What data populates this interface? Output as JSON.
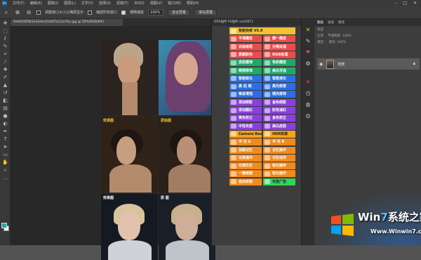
{
  "menubar": {
    "items": [
      "文件(F)",
      "编辑(E)",
      "图像(I)",
      "图层(L)",
      "文字(Y)",
      "选择(S)",
      "滤镜(T)",
      "3D(D)",
      "视图(V)",
      "窗口(W)",
      "帮助(H)"
    ],
    "app_logo": "Ps"
  },
  "options": {
    "resize_windows_label": "调整窗口大小以满屏显示",
    "zoom_all_label": "缩放所有窗口",
    "scrubby_zoom_label": "细微缩放",
    "zoom_value": "100%",
    "fit_screen_label": "适合屏幕",
    "fill_screen_label": "填充屏幕"
  },
  "document": {
    "tab_label": "6de62060b1e43dec41dd15a11e7ba.jpg @ 50%(RGB/8#)"
  },
  "photos": {
    "label_after_1": "效果图",
    "label_before_1": "原始图",
    "label_after_2": "效果图",
    "label_before_2": "原 图"
  },
  "plugin_panel": {
    "title": "DR5插件 PS插件 sw59KT1",
    "buttons": [
      {
        "label": "智能快修 V5.0",
        "color": "#f2c232"
      },
      {
        "label": "平滑磨皮",
        "color": "#e84c4c"
      },
      {
        "label": "磨一磨皮",
        "color": "#e84c4c"
      },
      {
        "label": "去除痘斑",
        "color": "#e84c4c"
      },
      {
        "label": "分频处理",
        "color": "#e84c4c"
      },
      {
        "label": "素颜肤色",
        "color": "#e84c4c"
      },
      {
        "label": "D&B处理",
        "color": "#e84c4c"
      },
      {
        "label": "皮肤磨滑",
        "color": "#1ea96a"
      },
      {
        "label": "色彩磨皮",
        "color": "#1ea96a"
      },
      {
        "label": "眼部修饰",
        "color": "#1ea96a"
      },
      {
        "label": "美白牙齿",
        "color": "#1ea96a"
      },
      {
        "label": "智能锐化",
        "color": "#2b6fe8"
      },
      {
        "label": "智能液化",
        "color": "#2b6fe8"
      },
      {
        "label": "高 低 频",
        "color": "#2b6fe8"
      },
      {
        "label": "高光修复",
        "color": "#2b6fe8"
      },
      {
        "label": "噪音增强",
        "color": "#2b6fe8"
      },
      {
        "label": "镜光修饰",
        "color": "#2b6fe8"
      },
      {
        "label": "添加眼影",
        "color": "#8a3fe0"
      },
      {
        "label": "金色眼影",
        "color": "#8a3fe0"
      },
      {
        "label": "添加腮红",
        "color": "#8a3fe0"
      },
      {
        "label": "肤色减红",
        "color": "#8a3fe0"
      },
      {
        "label": "黄色校正",
        "color": "#8a3fe0"
      },
      {
        "label": "金色校正",
        "color": "#8a3fe0"
      },
      {
        "label": "中性灰度",
        "color": "#8a3fe0"
      },
      {
        "label": "美白皮肤",
        "color": "#8a3fe0"
      },
      {
        "label": "Camera Raw",
        "color": "#f2a51c"
      },
      {
        "label": "HDR效果",
        "color": "#f2a51c"
      },
      {
        "label": "冲 光 A",
        "color": "#f28a1c"
      },
      {
        "label": "冲 光 B",
        "color": "#f28a1c"
      },
      {
        "label": "加载记忆",
        "color": "#f28a1c"
      },
      {
        "label": "记忆操作",
        "color": "#f28a1c"
      },
      {
        "label": "记录操作",
        "color": "#f28a1c"
      },
      {
        "label": "记忆动作",
        "color": "#f28a1c"
      },
      {
        "label": "记录历史",
        "color": "#f28a1c"
      },
      {
        "label": "锐化操作",
        "color": "#f28a1c"
      },
      {
        "label": "一键修图",
        "color": "#f28a1c"
      },
      {
        "label": "锐化操作",
        "color": "#f28a1c"
      },
      {
        "label": "自由定制",
        "color": "#f28a1c"
      },
      {
        "label": "可变广告",
        "color": "#2fd45a"
      }
    ]
  },
  "layers": {
    "tabs": [
      "图层",
      "通道",
      "路径"
    ],
    "kind_label": "类型",
    "mode_label": "正常",
    "opacity_label": "不透明度: 100%",
    "lock_label": "锁定:",
    "fill_label": "填充: 100%",
    "layer_name": "背景",
    "lock_icon": "lock-icon"
  },
  "watermark": {
    "brand_prefix": "Win",
    "brand_seven": "7",
    "brand_suffix": "系统之家",
    "url": "Www.Winwin7.com"
  }
}
